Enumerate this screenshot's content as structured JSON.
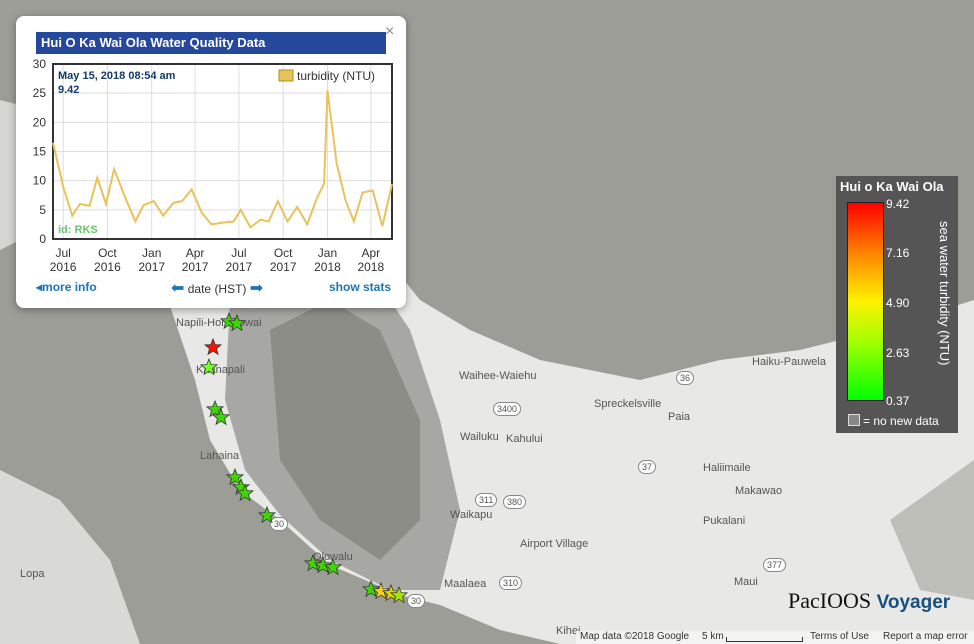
{
  "popup": {
    "title": "Hui O Ka Wai Ola Water Quality Data",
    "close": "×",
    "tooltip_date": "May 15, 2018 08:54 am",
    "tooltip_value": "9.42",
    "station_id": "id: RKS",
    "legend_label": "turbidity (NTU)",
    "more_info": "more info",
    "date_label": "date (HST)",
    "show_stats": "show stats"
  },
  "chart_data": {
    "type": "line",
    "ylim": [
      0,
      30
    ],
    "yticks": [
      "0",
      "5",
      "10",
      "15",
      "20",
      "25",
      "30"
    ],
    "xticks": [
      {
        "m": "Jul",
        "y": "2016"
      },
      {
        "m": "Oct",
        "y": "2016"
      },
      {
        "m": "Jan",
        "y": "2017"
      },
      {
        "m": "Apr",
        "y": "2017"
      },
      {
        "m": "Jul",
        "y": "2017"
      },
      {
        "m": "Oct",
        "y": "2017"
      },
      {
        "m": "Jan",
        "y": "2018"
      },
      {
        "m": "Apr",
        "y": "2018"
      }
    ],
    "series": [
      {
        "name": "turbidity (NTU)",
        "color": "#e8c25a",
        "points": [
          [
            "2016-06-10",
            16.5
          ],
          [
            "2016-07-01",
            9
          ],
          [
            "2016-07-20",
            4
          ],
          [
            "2016-08-05",
            6
          ],
          [
            "2016-08-25",
            5.7
          ],
          [
            "2016-09-10",
            10.5
          ],
          [
            "2016-09-28",
            6
          ],
          [
            "2016-10-15",
            12
          ],
          [
            "2016-11-05",
            7.5
          ],
          [
            "2016-11-28",
            3
          ],
          [
            "2016-12-15",
            5.8
          ],
          [
            "2017-01-05",
            6.5
          ],
          [
            "2017-01-25",
            4
          ],
          [
            "2017-02-15",
            6.2
          ],
          [
            "2017-03-05",
            6.5
          ],
          [
            "2017-03-25",
            8.5
          ],
          [
            "2017-04-15",
            4.5
          ],
          [
            "2017-05-05",
            2.5
          ],
          [
            "2017-05-28",
            2.8
          ],
          [
            "2017-06-20",
            3
          ],
          [
            "2017-07-05",
            5
          ],
          [
            "2017-07-25",
            2
          ],
          [
            "2017-08-15",
            3.3
          ],
          [
            "2017-09-01",
            3
          ],
          [
            "2017-09-20",
            6.5
          ],
          [
            "2017-10-10",
            3
          ],
          [
            "2017-10-30",
            5.5
          ],
          [
            "2017-11-20",
            2.5
          ],
          [
            "2017-12-10",
            7
          ],
          [
            "2017-12-25",
            9.5
          ],
          [
            "2018-01-01",
            25.5
          ],
          [
            "2018-01-20",
            13
          ],
          [
            "2018-02-08",
            6.5
          ],
          [
            "2018-02-25",
            3
          ],
          [
            "2018-03-15",
            8
          ],
          [
            "2018-04-05",
            8.3
          ],
          [
            "2018-04-25",
            2.2
          ],
          [
            "2018-05-15",
            9.42
          ]
        ]
      }
    ]
  },
  "legend": {
    "title": "Hui o Ka Wai Ola",
    "ticks": [
      "9.42",
      "7.16",
      "4.90",
      "2.63",
      "0.37"
    ],
    "axis_label": "sea water turbidity (NTU)",
    "no_new": "= no new data",
    "gradient": [
      "#ff0000",
      "#ff9000",
      "#fff200",
      "#9bff00",
      "#00ff00"
    ]
  },
  "map_labels": [
    "Napili-Honokowai",
    "Kaanapali",
    "Lahaina",
    "Olowalu",
    "Lopa",
    "Maalaea",
    "Waihee-Waiehu",
    "Wailuku",
    "Kahului",
    "Spreckelsville",
    "Paia",
    "Haiku-Pauwela",
    "Haliimaile",
    "Makawao",
    "Pukalani",
    "Waikapu",
    "Airport Village",
    "Maui",
    "Kihei",
    "Kahului"
  ],
  "station_colors": [
    "#3cd700",
    "#3cd700",
    "#ff1000",
    "#71ff25",
    "#3cd700",
    "#3cd700",
    "#3cd700",
    "#3cd700",
    "#3cd700",
    "#3cd700",
    "#3cd700",
    "#3cd700",
    "#3cd700",
    "#3cd700",
    "#f8d117",
    "#d9d600",
    "#9fe800"
  ],
  "attribution": {
    "map_data": "Map data ©2018 Google",
    "scale": "5 km",
    "terms": "Terms of Use",
    "report": "Report a map error"
  },
  "brand": {
    "name": "PacIOOS",
    "product": "Voyager"
  }
}
